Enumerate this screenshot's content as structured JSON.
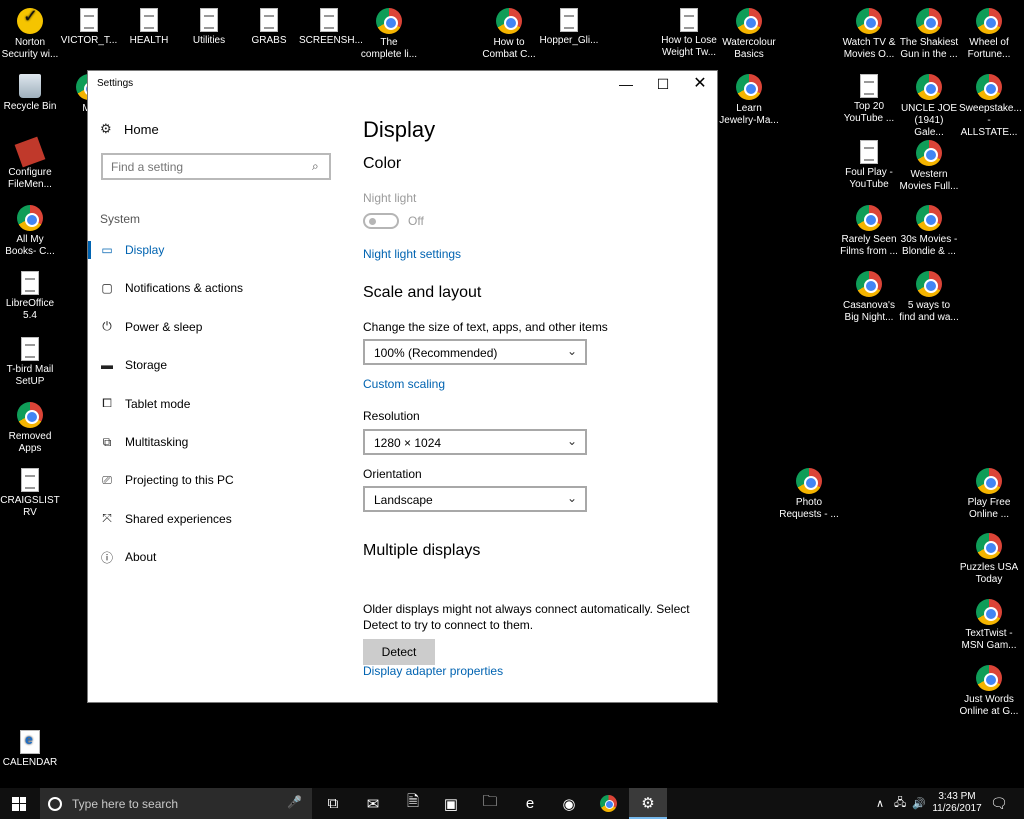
{
  "desktop": {
    "icons": [
      {
        "label": "Norton Security wi...",
        "icon": "norton-icon"
      },
      {
        "label": "VICTOR_T...",
        "icon": "document-icon"
      },
      {
        "label": "HEALTH",
        "icon": "document-icon"
      },
      {
        "label": "Utilities",
        "icon": "document-icon"
      },
      {
        "label": "GRABS",
        "icon": "document-icon"
      },
      {
        "label": "SCREENSH...",
        "icon": "document-icon"
      },
      {
        "label": "The complete li...",
        "icon": "chrome-icon"
      },
      {
        "label": "How to Combat C...",
        "icon": "chrome-icon"
      },
      {
        "label": "Hopper_Gli...",
        "icon": "document-icon"
      },
      {
        "label": "How to Lose Weight Tw...",
        "icon": "document-icon"
      },
      {
        "label": "Watercolour Basics",
        "icon": "chrome-icon"
      },
      {
        "label": "Watch TV & Movies O...",
        "icon": "chrome-icon"
      },
      {
        "label": "The Shakiest Gun in the ...",
        "icon": "chrome-icon"
      },
      {
        "label": "Wheel of Fortune...",
        "icon": "chrome-icon"
      },
      {
        "label": "Recycle Bin",
        "icon": "recycle-bin-icon"
      },
      {
        "label": "My",
        "icon": "chrome-icon"
      },
      {
        "label": "Learn Jewelry-Ma...",
        "icon": "chrome-icon"
      },
      {
        "label": "Top 20 YouTube ...",
        "icon": "document-icon"
      },
      {
        "label": "UNCLE JOE (1941) Gale...",
        "icon": "chrome-icon"
      },
      {
        "label": "Sweepstake... - ALLSTATE...",
        "icon": "chrome-icon"
      },
      {
        "label": "Configure FileMen...",
        "icon": "config-icon"
      },
      {
        "label": "Foul Play - YouTube",
        "icon": "document-icon"
      },
      {
        "label": "Western Movies Full...",
        "icon": "chrome-icon"
      },
      {
        "label": "All My Books- C...",
        "icon": "chrome-icon"
      },
      {
        "label": "Rarely Seen Films from ...",
        "icon": "chrome-icon"
      },
      {
        "label": "30s Movies - Blondie & ...",
        "icon": "chrome-icon"
      },
      {
        "label": "LibreOffice 5.4",
        "icon": "document-icon"
      },
      {
        "label": "Casanova's Big Night...",
        "icon": "chrome-icon"
      },
      {
        "label": "5 ways to find and wa...",
        "icon": "chrome-icon"
      },
      {
        "label": "T-bird Mail SetUP",
        "icon": "document-icon"
      },
      {
        "label": "Removed Apps",
        "icon": "chrome-icon"
      },
      {
        "label": "CRAIGSLIST RV",
        "icon": "document-icon"
      },
      {
        "label": "Photo Requests - ...",
        "icon": "chrome-icon"
      },
      {
        "label": "Play Free Online ...",
        "icon": "chrome-icon"
      },
      {
        "label": "Puzzles USA Today",
        "icon": "chrome-icon"
      },
      {
        "label": "TextTwist - MSN Gam...",
        "icon": "chrome-icon"
      },
      {
        "label": "Just Words Online at G...",
        "icon": "chrome-icon"
      },
      {
        "label": "CALENDAR",
        "icon": "pdf-icon"
      }
    ]
  },
  "window": {
    "title": "Settings",
    "controls": {
      "minimize": "—",
      "maximize": "☐",
      "close": "✕"
    }
  },
  "nav": {
    "home": "Home",
    "search_placeholder": "Find a setting",
    "section": "System",
    "items": [
      {
        "label": "Display",
        "icon": "display-icon",
        "active": true
      },
      {
        "label": "Notifications & actions",
        "icon": "notifications-icon"
      },
      {
        "label": "Power & sleep",
        "icon": "power-icon"
      },
      {
        "label": "Storage",
        "icon": "storage-icon"
      },
      {
        "label": "Tablet mode",
        "icon": "tablet-icon"
      },
      {
        "label": "Multitasking",
        "icon": "multitasking-icon"
      },
      {
        "label": "Projecting to this PC",
        "icon": "projecting-icon"
      },
      {
        "label": "Shared experiences",
        "icon": "shared-icon"
      },
      {
        "label": "About",
        "icon": "info-icon"
      }
    ]
  },
  "content": {
    "title": "Display",
    "color_heading": "Color",
    "night_light_label": "Night light",
    "night_light_state": "Off",
    "night_light_settings": "Night light settings",
    "scale_heading": "Scale and layout",
    "scale_label": "Change the size of text, apps, and other items",
    "scale_value": "100% (Recommended)",
    "custom_scaling": "Custom scaling",
    "resolution_label": "Resolution",
    "resolution_value": "1280 × 1024",
    "orientation_label": "Orientation",
    "orientation_value": "Landscape",
    "multi_heading": "Multiple displays",
    "multi_text": "Older displays might not always connect automatically. Select Detect to try to connect to them.",
    "detect_button": "Detect",
    "adapter_link": "Display adapter properties"
  },
  "taskbar": {
    "search_placeholder": "Type here to search",
    "time": "3:43 PM",
    "date": "11/26/2017"
  }
}
